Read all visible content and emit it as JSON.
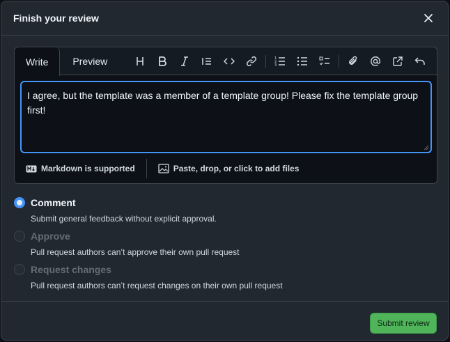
{
  "dialog": {
    "title": "Finish your review"
  },
  "editor": {
    "tabs": [
      {
        "label": "Write",
        "active": true
      },
      {
        "label": "Preview",
        "active": false
      }
    ],
    "toolbar_icons": [
      "heading-icon",
      "bold-icon",
      "italic-icon",
      "quote-icon",
      "code-icon",
      "link-icon",
      "ordered-list-icon",
      "unordered-list-icon",
      "task-list-icon",
      "attach-icon",
      "mention-icon",
      "reference-icon",
      "undo-icon"
    ],
    "text": "I agree, but the template was a member of a template group! Please fix the template group first!",
    "footer": {
      "markdown_label": "Markdown is supported",
      "files_label": "Paste, drop, or click to add files"
    }
  },
  "options": [
    {
      "label": "Comment",
      "description": "Submit general feedback without explicit approval.",
      "checked": true,
      "disabled": false
    },
    {
      "label": "Approve",
      "description": "Pull request authors can’t approve their own pull request",
      "checked": false,
      "disabled": true
    },
    {
      "label": "Request changes",
      "description": "Pull request authors can’t request changes on their own pull request",
      "checked": false,
      "disabled": true
    }
  ],
  "submit_label": "Submit review",
  "colors": {
    "accent": "#4493f8",
    "submit": "#4fb45a",
    "background": "#212830"
  }
}
